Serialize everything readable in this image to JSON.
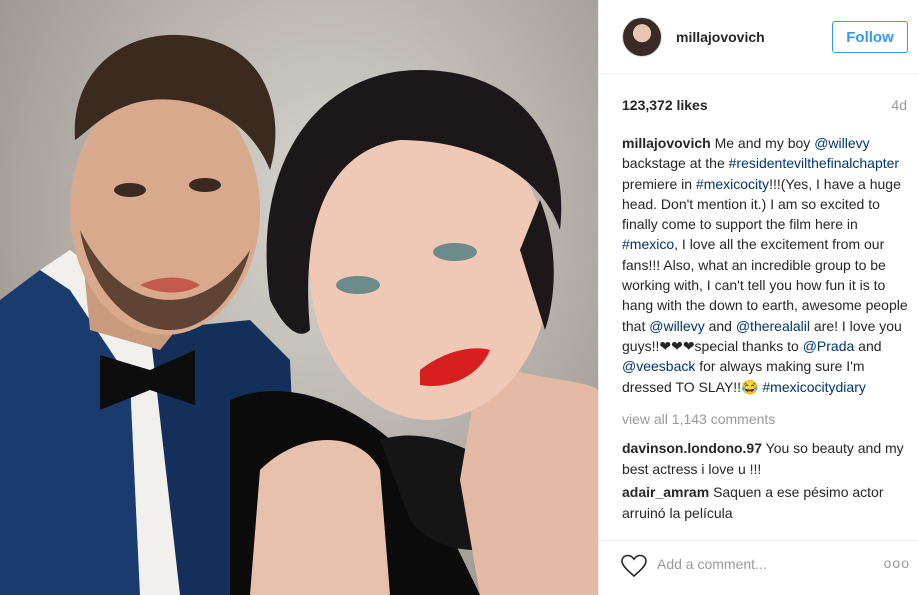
{
  "post": {
    "username": "millajovovich",
    "follow_label": "Follow",
    "likes": "123,372 likes",
    "age": "4d",
    "caption": {
      "author": "millajovovich",
      "segments": [
        {
          "text": "Me and my boy ",
          "type": "text"
        },
        {
          "text": "@willevy",
          "type": "link"
        },
        {
          "text": " backstage at the ",
          "type": "text"
        },
        {
          "text": "#residentevilthefinalchapter",
          "type": "link"
        },
        {
          "text": " premiere in ",
          "type": "text"
        },
        {
          "text": "#mexicocity",
          "type": "link"
        },
        {
          "text": "!!!(Yes, I have a huge head. Don't mention it.) I am so excited to finally come to support the film here in ",
          "type": "text"
        },
        {
          "text": "#mexico",
          "type": "link"
        },
        {
          "text": ", I love all the excitement from our fans!!! Also, what an incredible group to be working with, I can't tell you how fun it is to hang with the down to earth, awesome people that ",
          "type": "text"
        },
        {
          "text": "@willevy",
          "type": "link"
        },
        {
          "text": " and ",
          "type": "text"
        },
        {
          "text": "@therealalil",
          "type": "link"
        },
        {
          "text": " are! I love you guys!!❤❤❤special thanks to ",
          "type": "text"
        },
        {
          "text": "@Prada",
          "type": "link"
        },
        {
          "text": " and ",
          "type": "text"
        },
        {
          "text": "@veesback",
          "type": "link"
        },
        {
          "text": " for always making sure I'm dressed TO SLAY!!😂 ",
          "type": "text"
        },
        {
          "text": "#mexicocitydiary",
          "type": "link"
        }
      ]
    },
    "view_all_comments": "view all 1,143 comments",
    "comments": [
      {
        "author": "davinson.londono.97",
        "text": "You so beauty and my best actress i love u !!!"
      },
      {
        "author": "adair_amram",
        "text": "Saquen a ese pésimo actor arruinó la película"
      }
    ],
    "add_comment_placeholder": "Add a comment...",
    "more_label": "ooo"
  },
  "colors": {
    "follow_blue": "#3897f0",
    "link_blue": "#003569",
    "muted_gray": "#999999"
  },
  "icons": {
    "like": "heart-icon",
    "more": "more-options-icon"
  }
}
